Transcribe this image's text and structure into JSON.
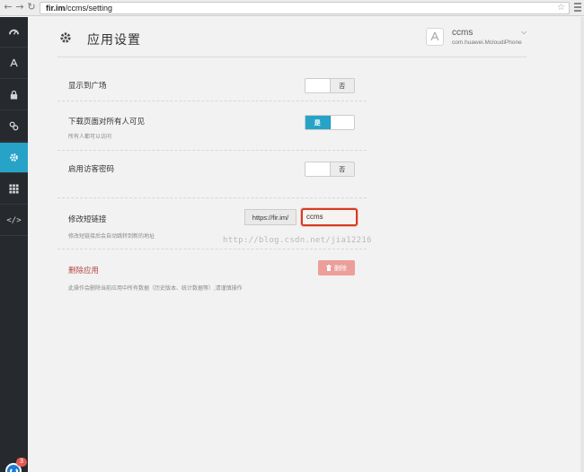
{
  "browser": {
    "url_host": "fir.im",
    "url_path": "/ccms/setting"
  },
  "sidebar": {
    "items": [
      {
        "icon": "dashboard-icon"
      },
      {
        "icon": "app-icon"
      },
      {
        "icon": "lock-icon"
      },
      {
        "icon": "link-icon"
      },
      {
        "icon": "gear-icon",
        "active": true
      },
      {
        "icon": "grid-icon"
      },
      {
        "icon": "code-icon",
        "text": "</>"
      }
    ],
    "notification_count": "3"
  },
  "header": {
    "title": "应用设置",
    "app_name": "ccms",
    "app_bundle": "com.huawei.McloudiPhone"
  },
  "settings": {
    "show_square": {
      "label": "显示到广场",
      "toggle": "否"
    },
    "download_public": {
      "label": "下载页面对所有人可见",
      "hint": "所有人都可以访问",
      "toggle": "是"
    },
    "guest_password": {
      "label": "启用访客密码",
      "toggle": "否"
    },
    "short_link": {
      "label": "修改短链接",
      "hint": "修改短链接后会自动跳转到新的地址",
      "prefix": "https://fir.im/",
      "value": "ccms"
    },
    "delete_app": {
      "label": "删除应用",
      "hint": "此操作会删除当前应用中所有数据（历史版本、统计数据等）,请谨慎操作",
      "button": "删除"
    }
  },
  "watermark": "http://blog.csdn.net/jia12216",
  "colors": {
    "accent": "#27a3c8",
    "danger": "#ec9e99",
    "highlight_border": "#d63a25",
    "sidebar_bg": "#262a2e"
  }
}
